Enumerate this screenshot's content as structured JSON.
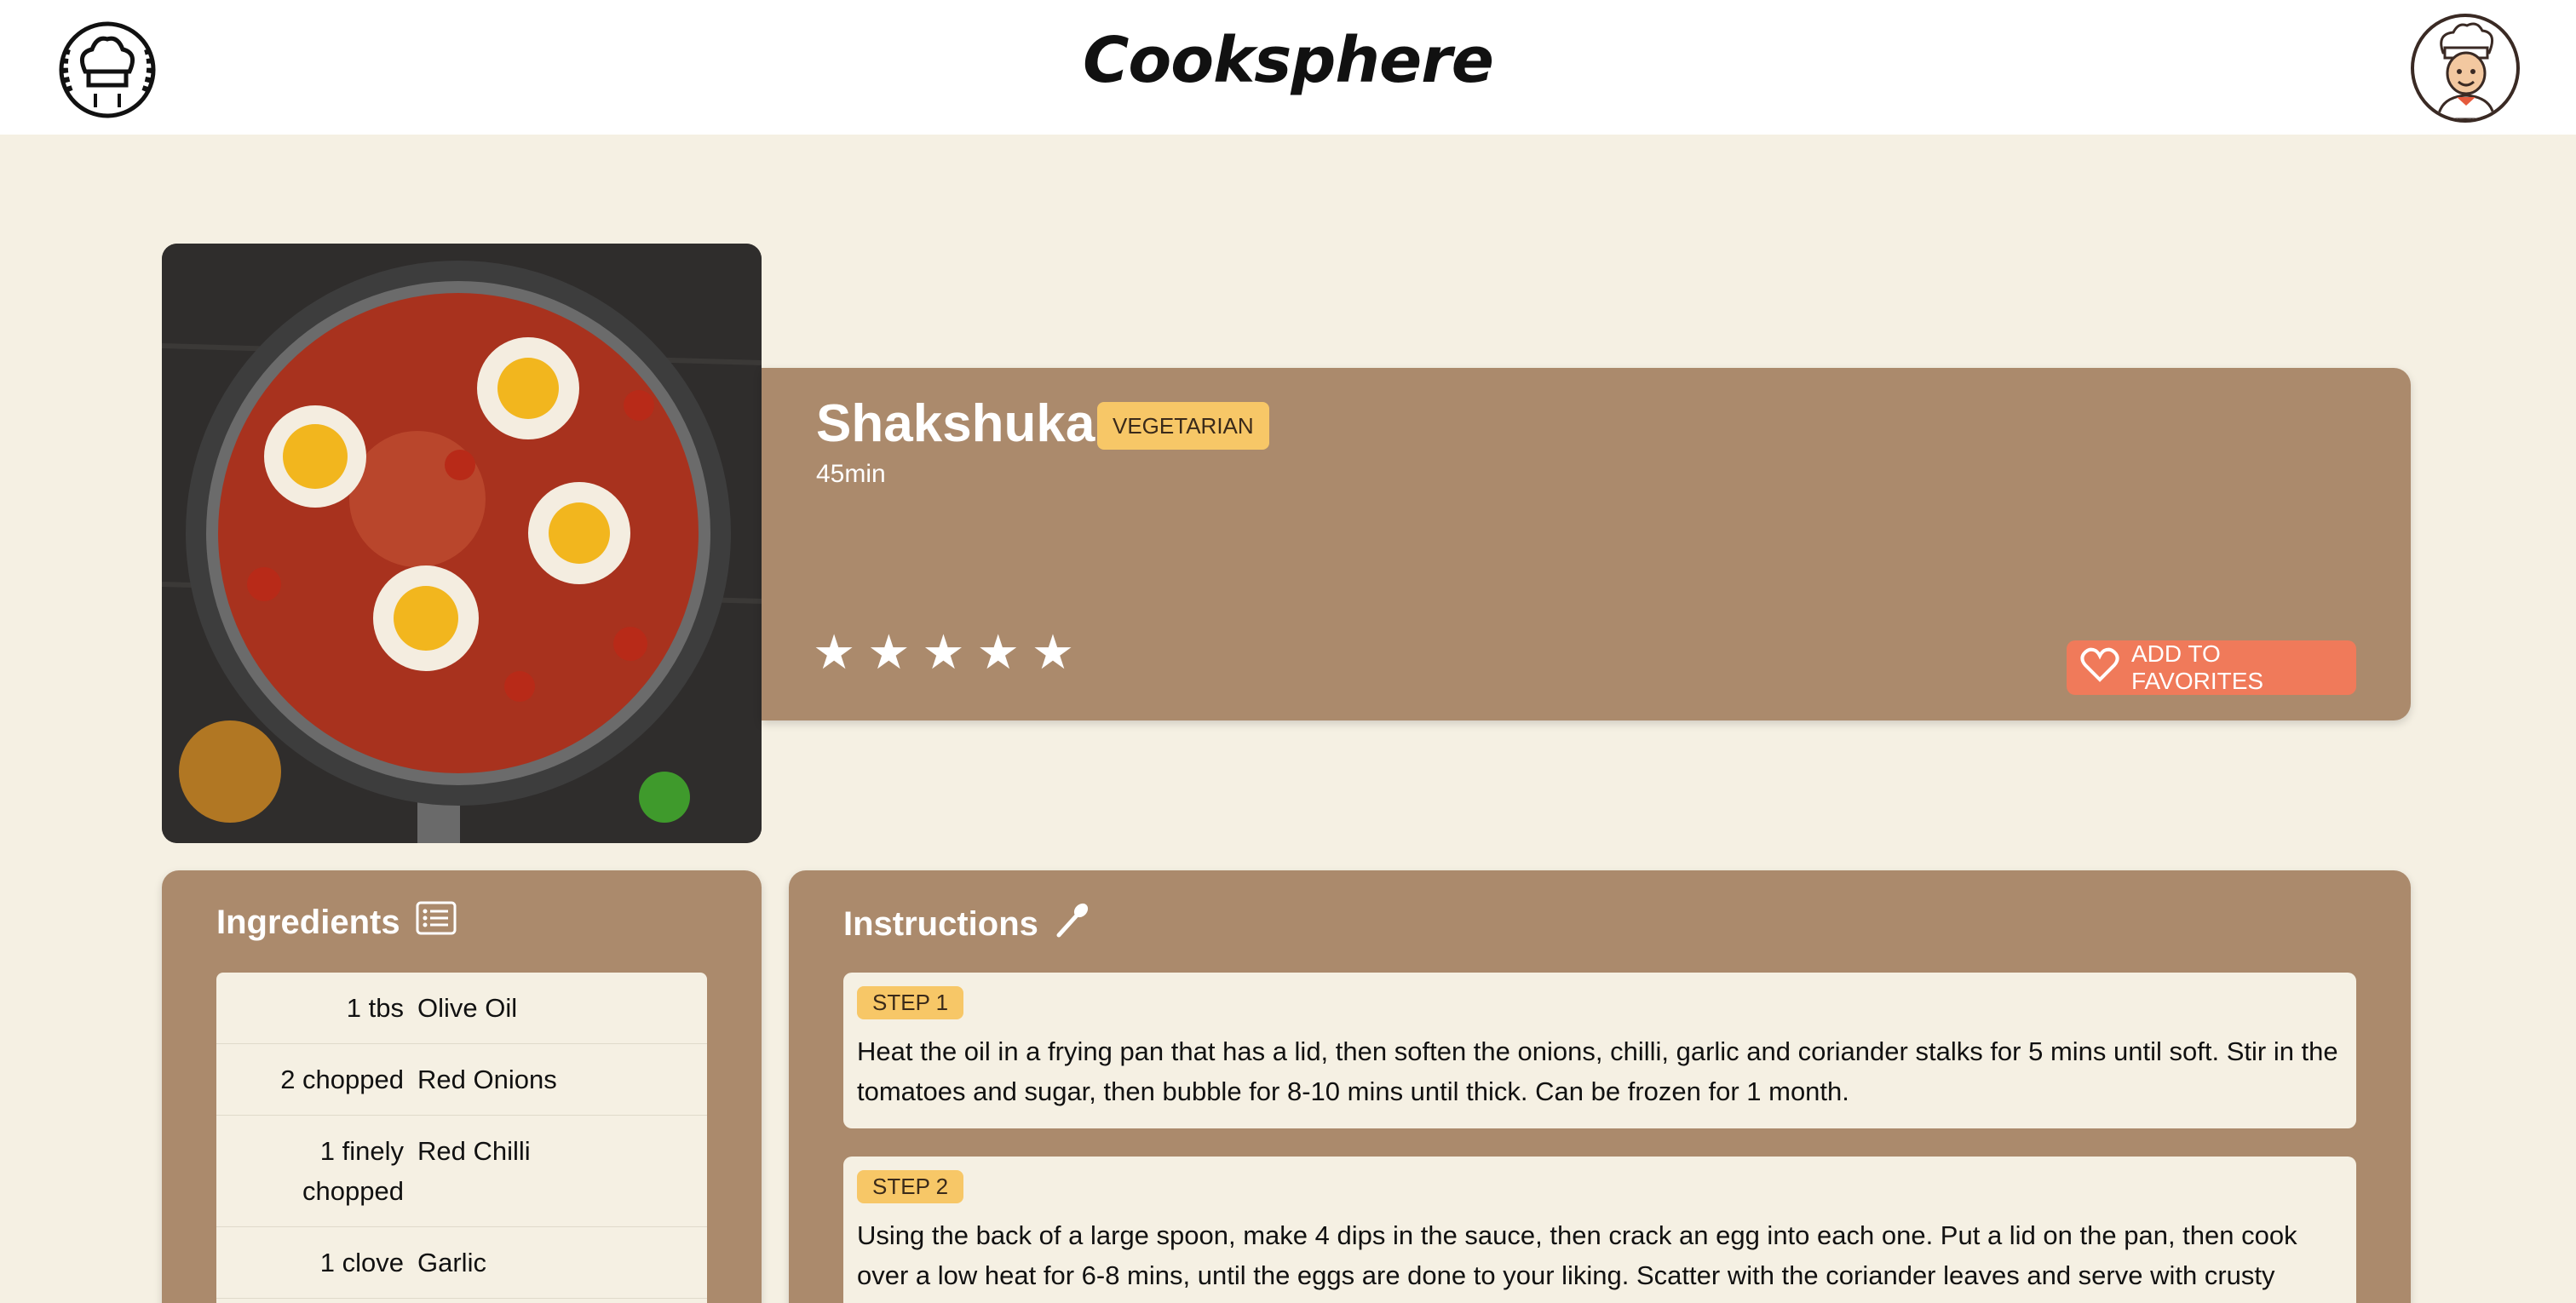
{
  "header": {
    "brand": "Cooksphere",
    "logo_icon": "chef-hat-logo-icon",
    "avatar_icon": "chef-avatar-icon"
  },
  "recipe": {
    "title": "Shakshuka",
    "badge": "VEGETARIAN",
    "time": "45min",
    "rating_stars": 5,
    "rating_filled": 0,
    "favorite_label": "ADD TO FAVORITES",
    "image_alt_icon": "shakshuka-pan-image"
  },
  "ingredients": {
    "title": "Ingredients",
    "icon": "list-icon",
    "items": [
      {
        "qty": "1 tbs",
        "name": "Olive Oil"
      },
      {
        "qty": "2 chopped",
        "name": "Red Onions"
      },
      {
        "qty": "1 finely chopped",
        "name": "Red Chilli"
      },
      {
        "qty": "1 clove",
        "name": "Garlic"
      }
    ]
  },
  "instructions": {
    "title": "Instructions",
    "icon": "spoon-icon",
    "steps": [
      {
        "label": "STEP 1",
        "text": "Heat the oil in a frying pan that has a lid, then soften the onions, chilli, garlic and coriander stalks for 5 mins until soft. Stir in the tomatoes and sugar, then bubble for 8-10 mins until thick. Can be frozen for 1 month."
      },
      {
        "label": "STEP 2",
        "text": "Using the back of a large spoon, make 4 dips in the sauce, then crack an egg into each one. Put a lid on the pan, then cook over a low heat for 6-8 mins, until the eggs are done to your liking. Scatter with the coriander leaves and serve with crusty"
      }
    ]
  },
  "colors": {
    "page_bg": "#f5f0e3",
    "card_bg": "#ab8a6c",
    "badge": "#f7c767",
    "favorite": "#f07a5a"
  }
}
